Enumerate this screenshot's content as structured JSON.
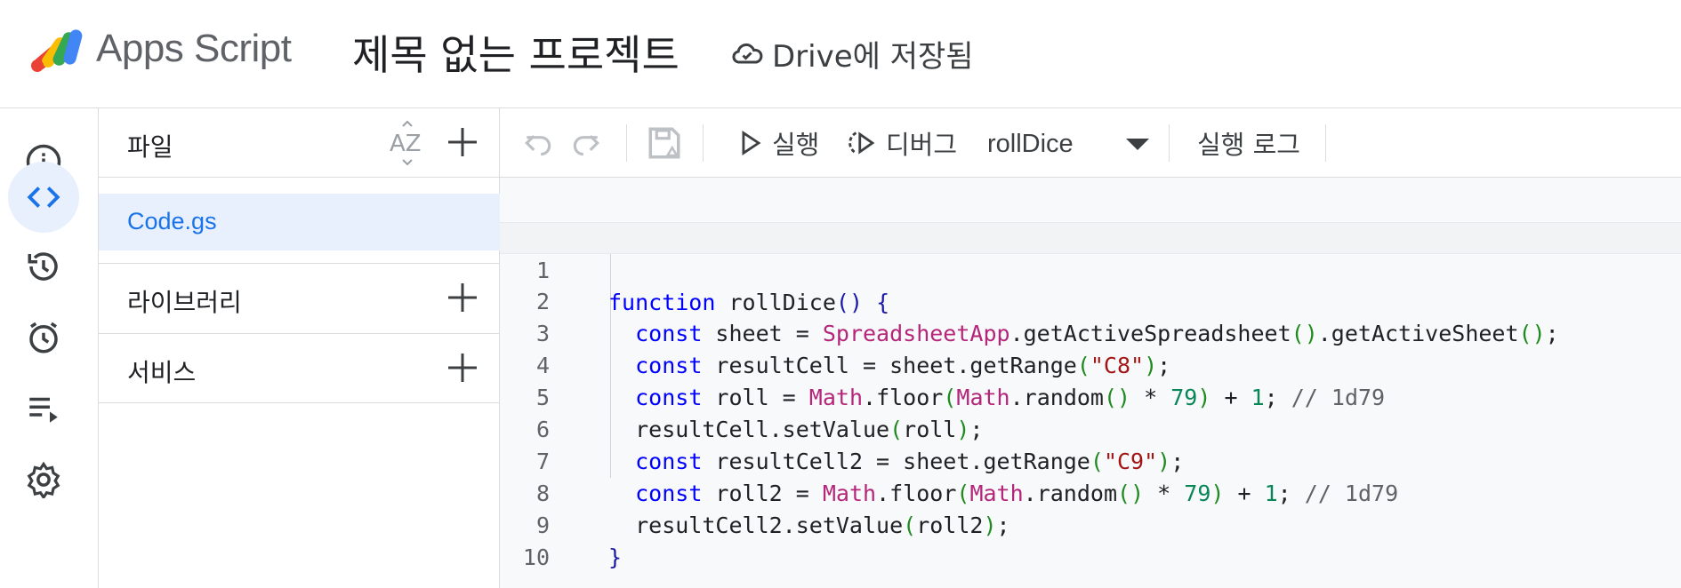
{
  "header": {
    "app_name": "Apps Script",
    "project_title": "제목 없는 프로젝트",
    "save_status": "Drive에 저장됨"
  },
  "files_panel": {
    "files_label": "파일",
    "libraries_label": "라이브러리",
    "services_label": "서비스",
    "files": [
      "Code.gs"
    ]
  },
  "toolbar": {
    "run_label": "실행",
    "debug_label": "디버그",
    "selected_function": "rollDice",
    "execution_log_label": "실행 로그"
  },
  "editor": {
    "line_numbers": [
      "1",
      "2",
      "3",
      "4",
      "5",
      "6",
      "7",
      "8",
      "9",
      "10"
    ],
    "lines": [
      "function rollDice() {",
      "  const sheet = SpreadsheetApp.getActiveSpreadsheet().getActiveSheet();",
      "  const resultCell = sheet.getRange(\"C8\");",
      "  const roll = Math.floor(Math.random() * 79) + 1; // 1d79",
      "  resultCell.setValue(roll);",
      "  const resultCell2 = sheet.getRange(\"C9\");",
      "  const roll2 = Math.floor(Math.random() * 79) + 1; // 1d79",
      "  resultCell2.setValue(roll2);",
      "}",
      ""
    ]
  },
  "icons": {
    "rail": [
      "info-icon",
      "code-icon",
      "history-icon",
      "alarm-icon",
      "executions-icon",
      "settings-icon"
    ]
  },
  "colors": {
    "accent": "#1a73e8",
    "active_bg": "#e8f0fe",
    "keyword": "#0000ff",
    "class": "#b5267a",
    "string": "#a31515",
    "number": "#098658"
  }
}
